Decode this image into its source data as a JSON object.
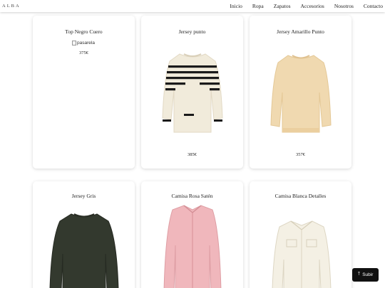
{
  "header": {
    "brand": "ALBA",
    "nav": [
      "Inicio",
      "Ropa",
      "Zapatos",
      "Accesorios",
      "Nosotros",
      "Contacto"
    ]
  },
  "products": [
    {
      "title": "Top Negro Cuero",
      "price": "375€",
      "image_alt": "pasarela"
    },
    {
      "title": "Jersey punto",
      "price": "385€"
    },
    {
      "title": "Jersey Amarillo Punto",
      "price": "357€"
    },
    {
      "title": "Jersey Gris",
      "price": ""
    },
    {
      "title": "Camisa Rosa Satén",
      "price": ""
    },
    {
      "title": "Camisa Blanca Detalles",
      "price": ""
    }
  ],
  "scroll_top": {
    "label": "Subir",
    "icon": "arrow-up-icon"
  },
  "colors": {
    "accent": "#111111",
    "card_bg": "#ffffff"
  }
}
